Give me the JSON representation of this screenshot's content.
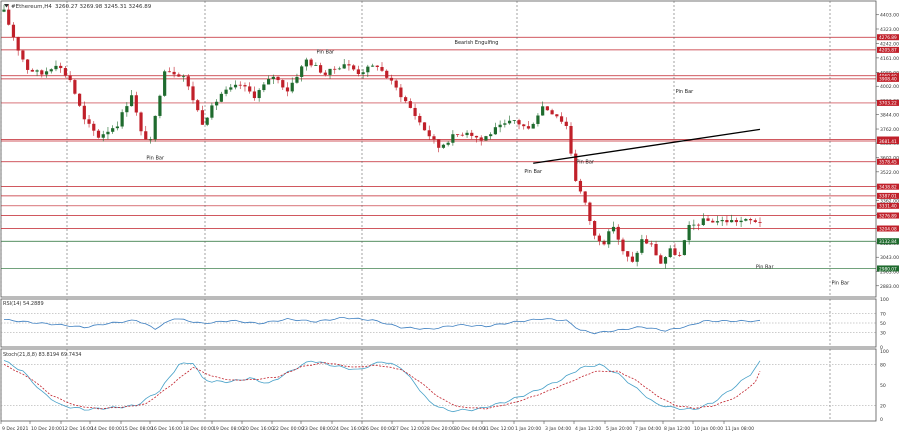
{
  "header": {
    "symbol_label": "#Ethereum,H4",
    "ohlc_label": "3260.27 3269.98 3245.31 3246.89"
  },
  "colors": {
    "bull": "#1f6b2e",
    "bear": "#c0202a",
    "level_red": "#c0202a",
    "level_green": "#1f6b2e",
    "rsi_line": "#3d7fc0",
    "stoch_main": "#46a0c8",
    "stoch_signal": "#c0202a",
    "trendline": "#000000",
    "grid": "#333333",
    "axis_text": "#333333"
  },
  "chart_data": [
    {
      "type": "candlestick",
      "title": "#Ethereum,H4",
      "ylim": [
        2820,
        4480
      ],
      "y_ticks": [
        "4403.00",
        "4323.00",
        "4242.00",
        "4161.00",
        "4080.00",
        "4002.00",
        "3923.00",
        "3844.00",
        "3762.00",
        "3683.00",
        "3602.00",
        "3522.00",
        "3442.00",
        "3362.00",
        "3282.00",
        "3203.00",
        "3123.00",
        "3043.00",
        "2963.00",
        "2883.00"
      ],
      "x_labels": [
        "9 Dec 2021",
        "10 Dec 20:00",
        "12 Dec 16:00",
        "14 Dec 00:00",
        "15 Dec 08:00",
        "16 Dec 16:00",
        "18 Dec 00:00",
        "19 Dec 08:00",
        "20 Dec 16:00",
        "22 Dec 00:00",
        "23 Dec 08:00",
        "24 Dec 16:00",
        "26 Dec 00:00",
        "27 Dec 12:00",
        "28 Dec 20:00",
        "30 Dec 04:00",
        "31 Dec 12:00",
        "1 Jan 20:00",
        "3 Jan 04:00",
        "4 Jan 12:00",
        "5 Jan 20:00",
        "7 Jan 04:00",
        "8 Jan 12:00",
        "10 Jan 00:00",
        "11 Jan 08:00"
      ],
      "anchors": [
        [
          0,
          4420
        ],
        [
          3,
          4210
        ],
        [
          5,
          4100
        ],
        [
          8,
          4070
        ],
        [
          11,
          4130
        ],
        [
          14,
          4040
        ],
        [
          17,
          3810
        ],
        [
          20,
          3720
        ],
        [
          24,
          3790
        ],
        [
          27,
          3960
        ],
        [
          29,
          3740
        ],
        [
          31,
          3690
        ],
        [
          34,
          4100
        ],
        [
          38,
          4060
        ],
        [
          42,
          3800
        ],
        [
          46,
          3960
        ],
        [
          50,
          4010
        ],
        [
          53,
          3950
        ],
        [
          57,
          4060
        ],
        [
          60,
          3980
        ],
        [
          64,
          4150
        ],
        [
          68,
          4070
        ],
        [
          72,
          4130
        ],
        [
          75,
          4080
        ],
        [
          79,
          4120
        ],
        [
          83,
          3990
        ],
        [
          86,
          3880
        ],
        [
          89,
          3760
        ],
        [
          92,
          3660
        ],
        [
          95,
          3720
        ],
        [
          98,
          3750
        ],
        [
          101,
          3700
        ],
        [
          104,
          3760
        ],
        [
          108,
          3810
        ],
        [
          111,
          3760
        ],
        [
          114,
          3890
        ],
        [
          117,
          3840
        ],
        [
          119,
          3780
        ],
        [
          121,
          3480
        ],
        [
          123,
          3340
        ],
        [
          125,
          3160
        ],
        [
          127,
          3130
        ],
        [
          129,
          3220
        ],
        [
          131,
          3070
        ],
        [
          133,
          3010
        ],
        [
          135,
          3140
        ],
        [
          137,
          3110
        ],
        [
          139,
          3010
        ],
        [
          141,
          3080
        ],
        [
          143,
          3050
        ],
        [
          145,
          3210
        ],
        [
          148,
          3246.89
        ]
      ],
      "levels": [
        {
          "label": "4276.89",
          "value": 4276.89,
          "color": "#c0202a"
        },
        {
          "label": "4205.87",
          "value": 4205.87,
          "color": "#c0202a"
        },
        {
          "label": "4060.60",
          "value": 4060.6,
          "color": "#c0202a"
        },
        {
          "label": "3908.40",
          "value": 4043.23,
          "color": "#c0202a"
        },
        {
          "label": "3703.22",
          "value": 3908.4,
          "color": "#c0202a"
        },
        {
          "label": "3694.87",
          "value": 3703.22,
          "color": "#c0202a"
        },
        {
          "label": "3681.41",
          "value": 3694.87,
          "color": "#c0202a"
        },
        {
          "label": "3578.45",
          "value": 3578.45,
          "color": "#c0202a"
        },
        {
          "label": "3438.82",
          "value": 3438.82,
          "color": "#c0202a"
        },
        {
          "label": "3387.01",
          "value": 3387.01,
          "color": "#c0202a"
        },
        {
          "label": "3331.40",
          "value": 3331.4,
          "color": "#c0202a"
        },
        {
          "label": "3276.89",
          "value": 3276.89,
          "color": "#c0202a"
        },
        {
          "label": "3204.08",
          "value": 3204.08,
          "color": "#c0202a"
        },
        {
          "label": "3132.84",
          "value": 3132.84,
          "color": "#1f6b2e"
        },
        {
          "label": "2980.07",
          "value": 2980.07,
          "color": "#1f6b2e"
        }
      ],
      "trendline": {
        "from": [
          112,
          3570
        ],
        "to": [
          160,
          3760
        ]
      },
      "annotations": [
        {
          "text": "Pin Bar",
          "x": 68,
          "y": 4185
        },
        {
          "text": "Bearish Engulfing",
          "x": 100,
          "y": 4240
        },
        {
          "text": "Pin Bar",
          "x": 32,
          "y": 3590
        },
        {
          "text": "Pin Bar",
          "x": 112,
          "y": 3515
        },
        {
          "text": "Pin Bar",
          "x": 123,
          "y": 3570
        },
        {
          "text": "Pin Bar",
          "x": 144,
          "y": 3965
        },
        {
          "text": "Pin Bar",
          "x": 161,
          "y": 2980
        },
        {
          "text": "Pin Bar",
          "x": 177,
          "y": 2890
        }
      ]
    },
    {
      "type": "line",
      "title": "RSI(14) 54.2889",
      "ylim": [
        0,
        100
      ],
      "y_ticks": [
        "100",
        "70",
        "50",
        "30",
        "0"
      ],
      "level_lines": [
        70,
        50,
        30
      ],
      "series": [
        {
          "name": "RSI(14) 54.2889",
          "anchors": [
            [
              0,
              57
            ],
            [
              6,
              51
            ],
            [
              12,
              46
            ],
            [
              17,
              41
            ],
            [
              22,
              49
            ],
            [
              28,
              56
            ],
            [
              32,
              38
            ],
            [
              36,
              60
            ],
            [
              42,
              49
            ],
            [
              48,
              55
            ],
            [
              54,
              49
            ],
            [
              60,
              58
            ],
            [
              66,
              53
            ],
            [
              72,
              61
            ],
            [
              78,
              56
            ],
            [
              84,
              41
            ],
            [
              90,
              37
            ],
            [
              96,
              46
            ],
            [
              102,
              43
            ],
            [
              108,
              52
            ],
            [
              114,
              59
            ],
            [
              119,
              55
            ],
            [
              122,
              35
            ],
            [
              125,
              29
            ],
            [
              130,
              35
            ],
            [
              135,
              42
            ],
            [
              140,
              34
            ],
            [
              145,
              44
            ],
            [
              148,
              54
            ]
          ]
        }
      ]
    },
    {
      "type": "line",
      "title": "Stoch(21,8,8) 83.8194 69.7434",
      "ylim": [
        0,
        100
      ],
      "y_ticks": [
        "100",
        "80",
        "50",
        "20",
        "0"
      ],
      "level_lines": [
        80,
        20
      ],
      "series": [
        {
          "name": "83.8194",
          "anchors": [
            [
              0,
              86
            ],
            [
              4,
              70
            ],
            [
              8,
              40
            ],
            [
              12,
              20
            ],
            [
              17,
              14
            ],
            [
              24,
              17
            ],
            [
              28,
              20
            ],
            [
              33,
              42
            ],
            [
              37,
              80
            ],
            [
              40,
              83
            ],
            [
              42,
              60
            ],
            [
              44,
              55
            ],
            [
              48,
              55
            ],
            [
              52,
              60
            ],
            [
              56,
              52
            ],
            [
              60,
              68
            ],
            [
              65,
              86
            ],
            [
              70,
              78
            ],
            [
              75,
              72
            ],
            [
              80,
              85
            ],
            [
              84,
              76
            ],
            [
              87,
              52
            ],
            [
              90,
              25
            ],
            [
              94,
              12
            ],
            [
              100,
              14
            ],
            [
              106,
              25
            ],
            [
              112,
              40
            ],
            [
              118,
              58
            ],
            [
              122,
              75
            ],
            [
              126,
              80
            ],
            [
              130,
              66
            ],
            [
              134,
              44
            ],
            [
              138,
              22
            ],
            [
              142,
              16
            ],
            [
              146,
              14
            ],
            [
              150,
              24
            ],
            [
              154,
              44
            ],
            [
              158,
              66
            ],
            [
              160,
              84
            ]
          ]
        },
        {
          "name": "69.7434",
          "anchors": [
            [
              0,
              80
            ],
            [
              6,
              58
            ],
            [
              10,
              35
            ],
            [
              15,
              20
            ],
            [
              20,
              15
            ],
            [
              26,
              18
            ],
            [
              30,
              22
            ],
            [
              35,
              48
            ],
            [
              40,
              76
            ],
            [
              44,
              63
            ],
            [
              48,
              57
            ],
            [
              53,
              58
            ],
            [
              58,
              62
            ],
            [
              63,
              77
            ],
            [
              68,
              83
            ],
            [
              74,
              76
            ],
            [
              79,
              79
            ],
            [
              84,
              73
            ],
            [
              88,
              55
            ],
            [
              92,
              32
            ],
            [
              96,
              18
            ],
            [
              102,
              15
            ],
            [
              108,
              24
            ],
            [
              114,
              38
            ],
            [
              120,
              55
            ],
            [
              125,
              70
            ],
            [
              130,
              70
            ],
            [
              134,
              56
            ],
            [
              138,
              35
            ],
            [
              142,
              20
            ],
            [
              146,
              16
            ],
            [
              150,
              19
            ],
            [
              155,
              32
            ],
            [
              159,
              54
            ],
            [
              160,
              70
            ]
          ]
        }
      ]
    }
  ]
}
